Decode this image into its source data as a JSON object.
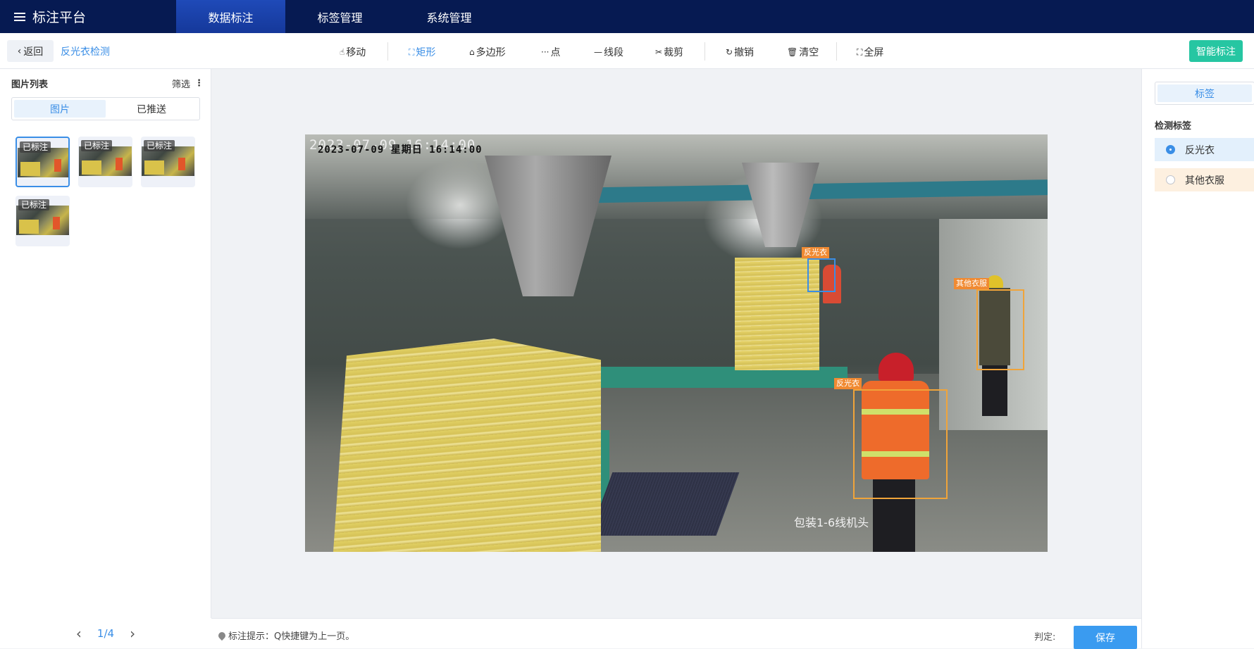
{
  "header": {
    "brand": "标注平台",
    "tabs": [
      {
        "label": "数据标注",
        "active": true
      },
      {
        "label": "标签管理",
        "active": false
      },
      {
        "label": "系统管理",
        "active": false
      }
    ],
    "bg_color": "#061a52"
  },
  "toolbar": {
    "back_label": "返回",
    "project_name": "反光衣检测",
    "tools": [
      {
        "label": "移动",
        "icon": "hand-icon",
        "active": false
      },
      {
        "label": "矩形",
        "icon": "rect-icon",
        "active": true
      },
      {
        "label": "多边形",
        "icon": "polygon-icon",
        "active": false
      },
      {
        "label": "点",
        "icon": "dots-icon",
        "active": false
      },
      {
        "label": "线段",
        "icon": "line-icon",
        "active": false
      },
      {
        "label": "裁剪",
        "icon": "scissors-icon",
        "active": false
      },
      {
        "label": "撤销",
        "icon": "undo-icon",
        "active": false
      },
      {
        "label": "清空",
        "icon": "trash-icon",
        "active": false
      },
      {
        "label": "全屏",
        "icon": "fullscreen-icon",
        "active": false
      }
    ],
    "smart_label": "智能标注",
    "smart_color": "#26c6a2"
  },
  "left_panel": {
    "title": "图片列表",
    "filter_label": "筛选",
    "segments": [
      {
        "label": "图片",
        "active": true
      },
      {
        "label": "已推送",
        "active": false
      }
    ],
    "thumbnails": [
      {
        "tag": "已标注",
        "selected": true
      },
      {
        "tag": "已标注",
        "selected": false
      },
      {
        "tag": "已标注",
        "selected": false
      },
      {
        "tag": "已标注",
        "selected": false
      }
    ],
    "pager": {
      "text": "1/4"
    }
  },
  "canvas": {
    "timestamp": "2023-07-09 16:14:00",
    "timestamp_overlay": "2023-07-09  星期日  16:14:00",
    "location_text": "包装1-6线机头",
    "annotations": [
      {
        "label": "反光衣",
        "color": "#3a8ee6"
      },
      {
        "label": "其他衣服",
        "color": "#f0a43a"
      },
      {
        "label": "反光衣",
        "color": "#f0a43a"
      }
    ]
  },
  "right_panel": {
    "tab_label": "标签",
    "section_title": "检测标签",
    "labels": [
      {
        "label": "反光衣",
        "selected": true,
        "bg": "#e3f0fc"
      },
      {
        "label": "其他衣服",
        "selected": false,
        "bg": "#fdf0e0"
      }
    ]
  },
  "bottombar": {
    "hint": "标注提示：Q快捷键为上一页。",
    "judge_label": "判定:",
    "save_label": "保存"
  }
}
